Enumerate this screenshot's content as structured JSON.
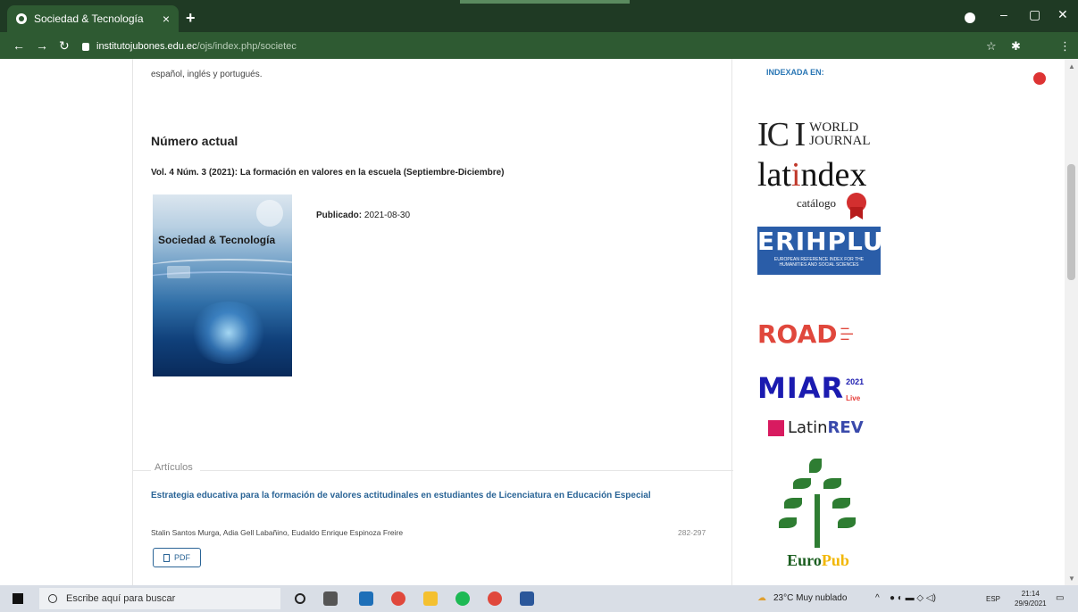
{
  "browser": {
    "tab_title": "Sociedad & Tecnología",
    "tab_close": "×",
    "new_tab": "+",
    "url_domain": "institutojubones.edu.ec",
    "url_path": "/ojs/index.php/societec",
    "window_minimize": "–",
    "window_restore": "▢",
    "window_close": "✕"
  },
  "page": {
    "intro_text": "español, inglés y portugués.",
    "section_title": "Número actual",
    "issue_title": "Vol. 4 Núm. 3 (2021): La formación en valores en la escuela (Septiembre-Diciembre)",
    "cover_title": "Sociedad & Tecnología",
    "published_label": "Publicado:",
    "published_date": "2021-08-30",
    "articles_label": "Artículos",
    "articles": [
      {
        "title": "Estrategia educativa para la formación de valores actitudinales en estudiantes de Licenciatura en Educación Especial",
        "authors": "Stalin Santos Murga, Adia Gell Labañino, Eudaldo Enrique Espinoza Freire",
        "pages": "282-297",
        "pdf_label": "PDF"
      }
    ]
  },
  "sidebar": {
    "indexed_label": "INDEXADA EN:",
    "logos": {
      "ici_letters": "IC I",
      "ici_world": "WORLD",
      "ici_journal": "JOURNAL",
      "latindex_pre": "lat",
      "latindex_i": "i",
      "latindex_post": "ndex",
      "latindex_catalog": "catálogo",
      "erih_big": "ERIHPLUS",
      "erih_small": "EUROPEAN REFERENCE INDEX FOR THE HUMANITIES AND SOCIAL SCIENCES",
      "road": "ROAD",
      "miar": "MIAR",
      "miar_year": "2021",
      "miar_live": "Live",
      "latinrev_pre": "Latin",
      "latinrev_post": "REV",
      "europub_euro": "Euro",
      "europub_pub": "Pub"
    }
  },
  "taskbar": {
    "search_placeholder": "Escribe aquí para buscar",
    "weather": "23°C  Muy nublado",
    "language": "ESP",
    "time": "21:14",
    "date": "29/9/2021"
  },
  "colors": {
    "browser_frame": "#1f3a24",
    "link": "#2a6496",
    "index_label": "#2b77b5"
  }
}
